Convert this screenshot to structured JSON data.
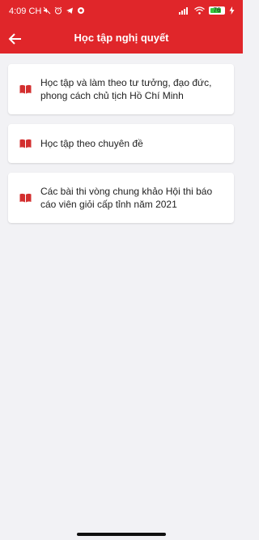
{
  "status_bar": {
    "time": "4:09 CH",
    "battery_level": "76",
    "icons": [
      "mute-icon",
      "alarm-icon",
      "telegram-icon",
      "app-icon",
      "signal-icon",
      "wifi-icon",
      "battery-icon",
      "charging-icon"
    ]
  },
  "app_bar": {
    "title": "Học tập nghị quyết",
    "back_icon": "arrow-left-icon"
  },
  "items": [
    {
      "label": "Học tập và làm theo tư tưởng, đạo đức, phong cách chủ tịch Hồ Chí Minh",
      "icon": "book-icon"
    },
    {
      "label": "Học tập theo chuyên đề",
      "icon": "book-icon"
    },
    {
      "label": "Các bài thi vòng chung khảo Hội thi báo cáo viên giỏi cấp tỉnh năm 2021",
      "icon": "book-icon"
    }
  ],
  "colors": {
    "primary": "#e0262a",
    "background": "#f2f2f5",
    "card": "#ffffff",
    "icon": "#d32f2f",
    "text": "#222222"
  }
}
